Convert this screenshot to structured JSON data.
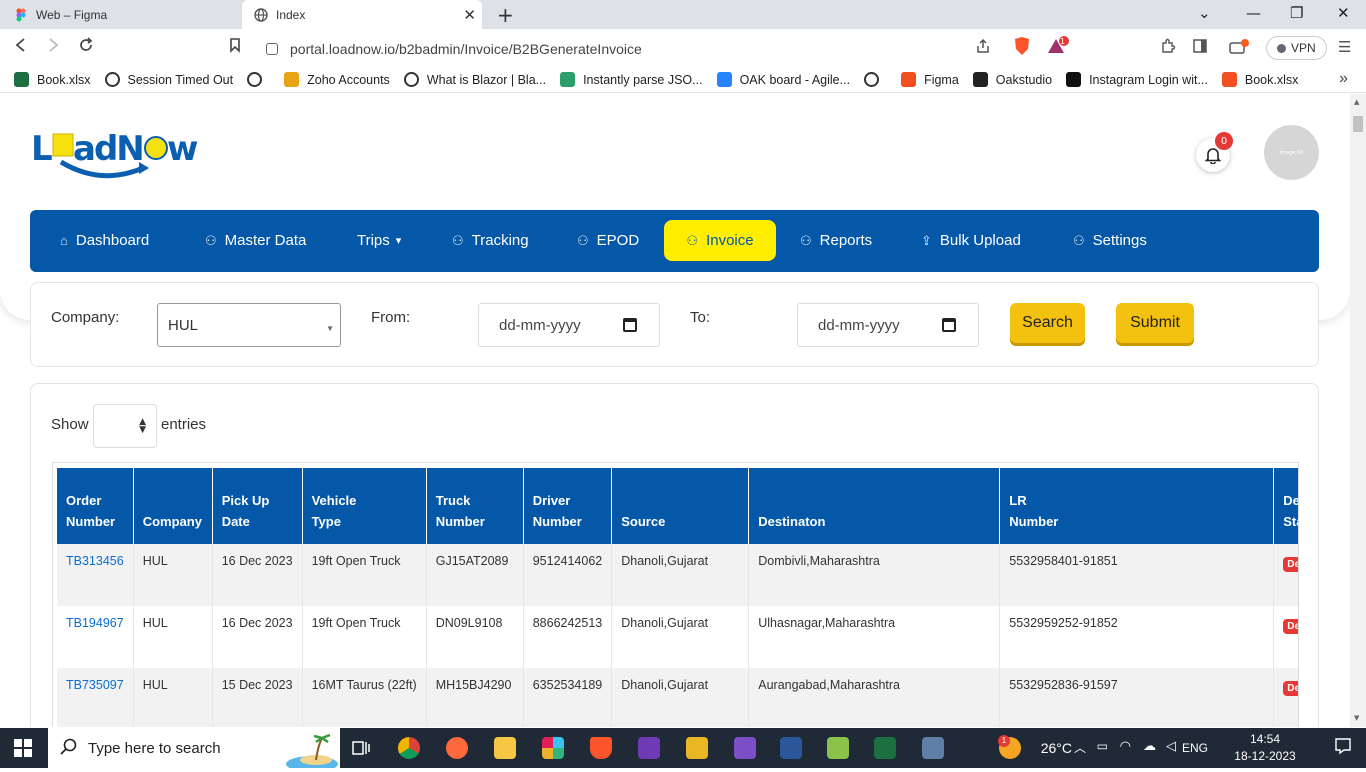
{
  "browser": {
    "tabs": [
      {
        "label": "Web – Figma"
      },
      {
        "label": "Index"
      }
    ],
    "url": "portal.loadnow.io/b2badmin/Invoice/B2BGenerateInvoice",
    "vpn_label": "VPN",
    "brave_badge": "1"
  },
  "bookmarks": [
    {
      "label": "Book.xlsx",
      "icon": "excel-icon",
      "color": "#1d6f42"
    },
    {
      "label": "Session Timed Out",
      "icon": "globe-icon",
      "color": "#333"
    },
    {
      "label": "",
      "icon": "globe-icon",
      "color": "#333"
    },
    {
      "label": "Zoho Accounts",
      "icon": "zoho-icon",
      "color": "#e8a317"
    },
    {
      "label": "What is Blazor | Bla...",
      "icon": "globe-icon",
      "color": "#333"
    },
    {
      "label": "Instantly parse JSO...",
      "icon": "quicktype-icon",
      "color": "#2c9e6b"
    },
    {
      "label": "OAK board - Agile...",
      "icon": "jira-icon",
      "color": "#2684ff"
    },
    {
      "label": "",
      "icon": "globe-icon",
      "color": "#333"
    },
    {
      "label": "Figma",
      "icon": "figma-icon",
      "color": "#f24e1e"
    },
    {
      "label": "Oakstudio",
      "icon": "oakstudio-icon",
      "color": "#222"
    },
    {
      "label": "Instagram Login wit...",
      "icon": "instagram-icon",
      "color": "#111"
    },
    {
      "label": "Book.xlsx",
      "icon": "office-icon",
      "color": "#f25022"
    }
  ],
  "header": {
    "logo_text": "LoadNow",
    "notification_count": "0",
    "avatar_text": "Image Alt"
  },
  "nav": {
    "items": [
      {
        "label": "Dashboard",
        "icon": "home-icon"
      },
      {
        "label": "Master Data",
        "icon": "users-icon"
      },
      {
        "label": "Trips",
        "icon": "",
        "dropdown": true
      },
      {
        "label": "Tracking",
        "icon": "users-icon"
      },
      {
        "label": "EPOD",
        "icon": "users-icon"
      },
      {
        "label": "Invoice",
        "icon": "users-icon",
        "active": true
      },
      {
        "label": "Reports",
        "icon": "users-icon"
      },
      {
        "label": "Bulk Upload",
        "icon": "upload-icon"
      },
      {
        "label": "Settings",
        "icon": "users-icon"
      }
    ]
  },
  "filters": {
    "company_label": "Company:",
    "company_value": "HUL",
    "from_label": "From:",
    "from_placeholder": "dd-mm-yyyy",
    "to_label": "To:",
    "to_placeholder": "dd-mm-yyyy",
    "search_label": "Search",
    "submit_label": "Submit"
  },
  "table": {
    "show_label": "Show",
    "entries_label": "entries",
    "columns": [
      {
        "line1": "Order",
        "line2": "Number"
      },
      {
        "line1": "",
        "line2": "Company"
      },
      {
        "line1": "Pick Up",
        "line2": "Date"
      },
      {
        "line1": "Vehicle",
        "line2": "Type"
      },
      {
        "line1": "Truck",
        "line2": "Number"
      },
      {
        "line1": "Driver",
        "line2": "Number"
      },
      {
        "line1": "",
        "line2": "Source"
      },
      {
        "line1": "",
        "line2": "Destinaton"
      },
      {
        "line1": "LR",
        "line2": "Number"
      },
      {
        "line1": "Deli",
        "line2": "Stat"
      }
    ],
    "rows": [
      {
        "order": "TB313456",
        "company": "HUL",
        "date": "16 Dec 2023",
        "vehicle": "19ft Open Truck",
        "truck": "GJ15AT2089",
        "driver": "9512414062",
        "source": "Dhanoli,Gujarat",
        "dest": "Dombivli,Maharashtra",
        "lr": "5532958401-91851",
        "status": "Deli"
      },
      {
        "order": "TB194967",
        "company": "HUL",
        "date": "16 Dec 2023",
        "vehicle": "19ft Open Truck",
        "truck": "DN09L9108",
        "driver": "8866242513",
        "source": "Dhanoli,Gujarat",
        "dest": "Ulhasnagar,Maharashtra",
        "lr": "5532959252-91852",
        "status": "Deli"
      },
      {
        "order": "TB735097",
        "company": "HUL",
        "date": "15 Dec 2023",
        "vehicle": "16MT Taurus (22ft)",
        "truck": "MH15BJ4290",
        "driver": "6352534189",
        "source": "Dhanoli,Gujarat",
        "dest": "Aurangabad,Maharashtra",
        "lr": "5532952836-91597",
        "status": "Deli"
      }
    ]
  },
  "taskbar": {
    "search_placeholder": "Type here to search",
    "weather": "26°C",
    "weather_badge": "1",
    "language": "ENG",
    "time": "14:54",
    "date": "18-12-2023"
  }
}
